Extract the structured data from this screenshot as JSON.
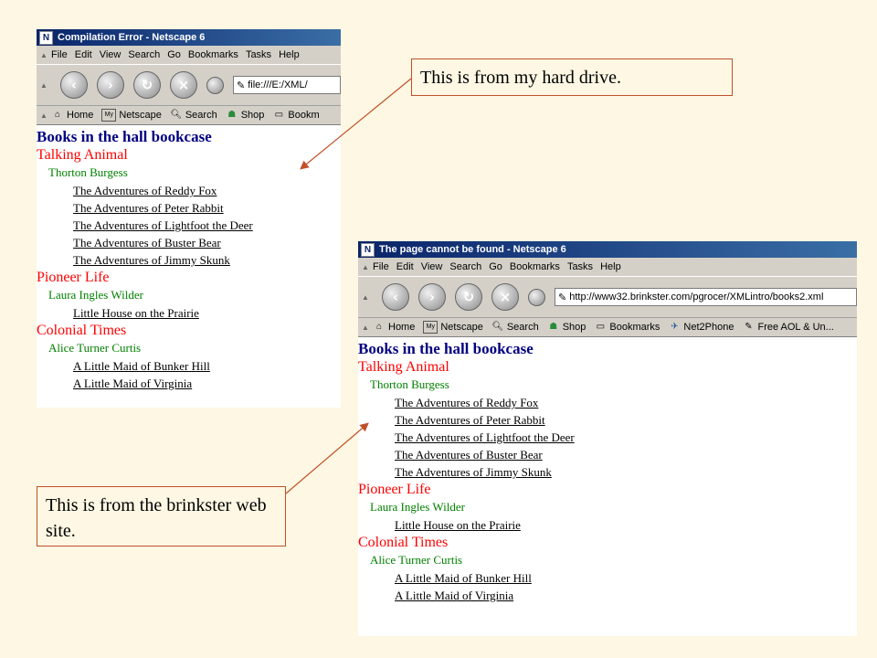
{
  "window1": {
    "title": "Compilation Error - Netscape 6",
    "menu": [
      "File",
      "Edit",
      "View",
      "Search",
      "Go",
      "Bookmarks",
      "Tasks",
      "Help"
    ],
    "url": "file:///E:/XML/",
    "personal_bar": [
      "Home",
      "Netscape",
      "Search",
      "Shop",
      "Bookm"
    ]
  },
  "window2": {
    "title": "The page cannot be found - Netscape 6",
    "menu": [
      "File",
      "Edit",
      "View",
      "Search",
      "Go",
      "Bookmarks",
      "Tasks",
      "Help"
    ],
    "url": "http://www32.brinkster.com/pgrocer/XMLintro/books2.xml",
    "personal_bar": [
      "Home",
      "Netscape",
      "Search",
      "Shop",
      "Bookmarks",
      "Net2Phone",
      "Free AOL & Un..."
    ]
  },
  "bookcase": {
    "heading": "Books in the hall bookcase",
    "categories": [
      {
        "name": "Talking Animal",
        "author": "Thorton Burgess",
        "books": [
          "The Adventures of Reddy Fox",
          "The Adventures of Peter Rabbit",
          "The Adventures of Lightfoot the Deer",
          "The Adventures of Buster Bear",
          "The Adventures of Jimmy Skunk"
        ]
      },
      {
        "name": "Pioneer Life",
        "author": "Laura Ingles Wilder",
        "books": [
          "Little House on the Prairie"
        ]
      },
      {
        "name": "Colonial Times",
        "author": "Alice Turner Curtis",
        "books": [
          "A Little Maid of Bunker Hill",
          "A Little Maid of Virginia"
        ]
      }
    ]
  },
  "callouts": {
    "hard_drive": "This is from my hard drive.",
    "brinkster": "This is from the brinkster web site."
  },
  "colors": {
    "background": "#fdf7e3",
    "heading": "#000080",
    "category": "#ff0000",
    "author": "#008000",
    "callout_border": "#c0502a",
    "titlebar": "#0a246a"
  },
  "icons": {
    "back": "back-arrow-icon",
    "forward": "forward-arrow-icon",
    "reload": "reload-icon",
    "stop": "stop-icon"
  }
}
